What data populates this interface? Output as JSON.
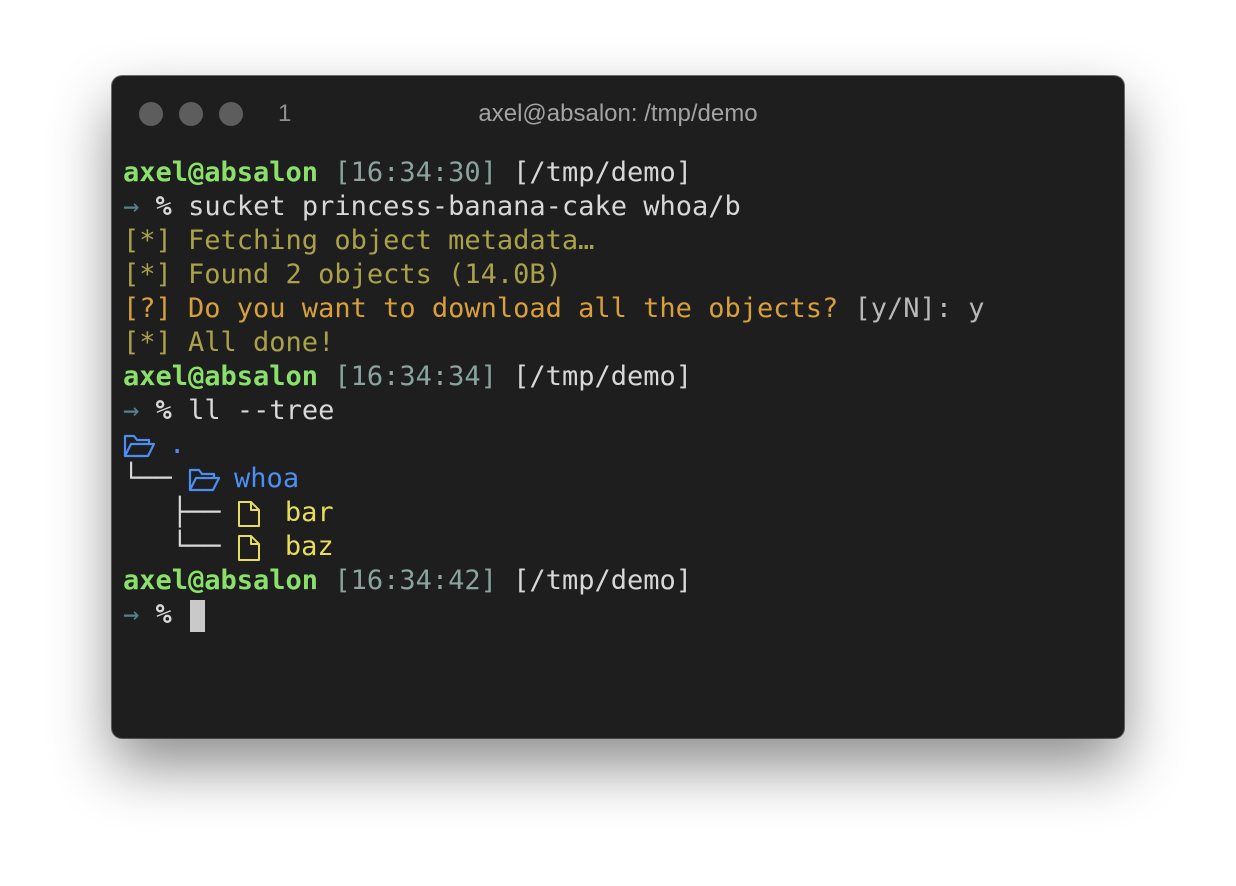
{
  "window": {
    "tab_number": "1",
    "title": "axel@absalon: /tmp/demo"
  },
  "colors": {
    "background": "#1e1e1e",
    "user": "#8ae06b",
    "time": "#8aa39f",
    "arrow": "#52828a",
    "info": "#aaa24a",
    "ask": "#d8a03d",
    "directory": "#4c8ef2",
    "file": "#e6dd5a"
  },
  "terminal": {
    "prompts": [
      {
        "user": "axel@absalon",
        "time": "[16:34:30]",
        "path": "[/tmp/demo]",
        "arrow": "→",
        "symbol": "%",
        "command": "sucket princess-banana-cake whoa/b"
      },
      {
        "user": "axel@absalon",
        "time": "[16:34:34]",
        "path": "[/tmp/demo]",
        "arrow": "→",
        "symbol": "%",
        "command": "ll --tree"
      },
      {
        "user": "axel@absalon",
        "time": "[16:34:42]",
        "path": "[/tmp/demo]",
        "arrow": "→",
        "symbol": "%",
        "command": ""
      }
    ],
    "output": {
      "fetching": "[*] Fetching object metadata…",
      "found": "[*] Found 2 objects (14.0B)",
      "question": "[?] Do you want to download all the objects?",
      "answer_hint": " [y/N]: y",
      "done": "[*] All done!"
    },
    "tree": {
      "root": ".",
      "dir_branch": "└──",
      "dir_name": "whoa",
      "file_branch_mid": "├──",
      "file_branch_last": "└──",
      "files": [
        "bar",
        "baz"
      ],
      "icons": {
        "folder": "folder-open-icon",
        "file": "file-icon"
      }
    }
  }
}
